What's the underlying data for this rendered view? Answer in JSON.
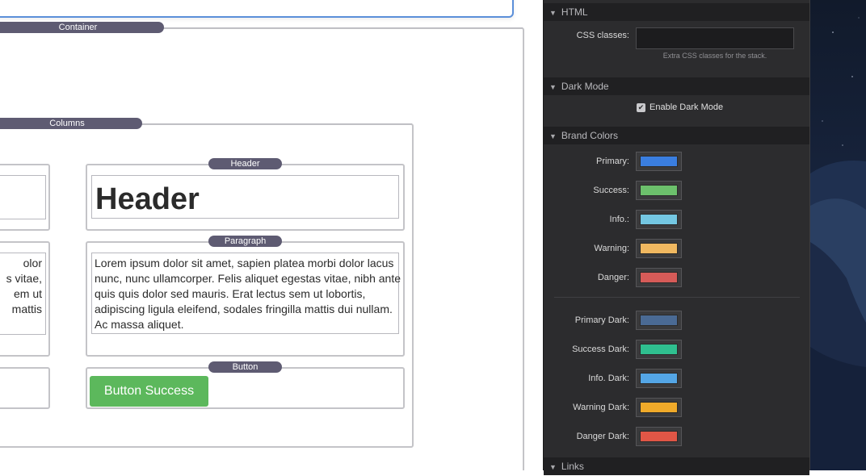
{
  "canvas": {
    "labels": {
      "container": "Container",
      "columns": "Columns",
      "header": "Header",
      "paragraph": "Paragraph",
      "button": "Button"
    },
    "header_text": "Header",
    "paragraph_text": "Lorem ipsum dolor sit amet, sapien platea morbi dolor lacus nunc, nunc ullamcorper. Felis aliquet egestas vitae, nibh ante quis quis dolor sed mauris. Erat lectus sem ut lobortis, adipiscing ligula eleifend, sodales fringilla mattis dui nullam. Ac massa aliquet.",
    "left_paragraph_fragment": "olor\ns vitae,\nem ut\nmattis",
    "button_label": "Button Success"
  },
  "inspector": {
    "html_section": {
      "title": "HTML",
      "css_label": "CSS classes:",
      "css_value": "",
      "css_hint": "Extra CSS classes for the stack."
    },
    "dark_mode_section": {
      "title": "Dark Mode",
      "enable_label": "Enable Dark Mode",
      "enabled": true
    },
    "brand_colors_section": {
      "title": "Brand Colors",
      "colors": [
        {
          "label": "Primary:",
          "hex": "#3a7ee0"
        },
        {
          "label": "Success:",
          "hex": "#6cc06c"
        },
        {
          "label": "Info.:",
          "hex": "#74c7e2"
        },
        {
          "label": "Warning:",
          "hex": "#f0b860"
        },
        {
          "label": "Danger:",
          "hex": "#d65b58"
        },
        {
          "label": "Primary Dark:",
          "hex": "#4a6a94"
        },
        {
          "label": "Success Dark:",
          "hex": "#2fbf8f"
        },
        {
          "label": "Info. Dark:",
          "hex": "#54a6e6"
        },
        {
          "label": "Warning Dark:",
          "hex": "#f0aa2a"
        },
        {
          "label": "Danger Dark:",
          "hex": "#e05646"
        }
      ]
    },
    "links_section": {
      "title": "Links"
    }
  }
}
